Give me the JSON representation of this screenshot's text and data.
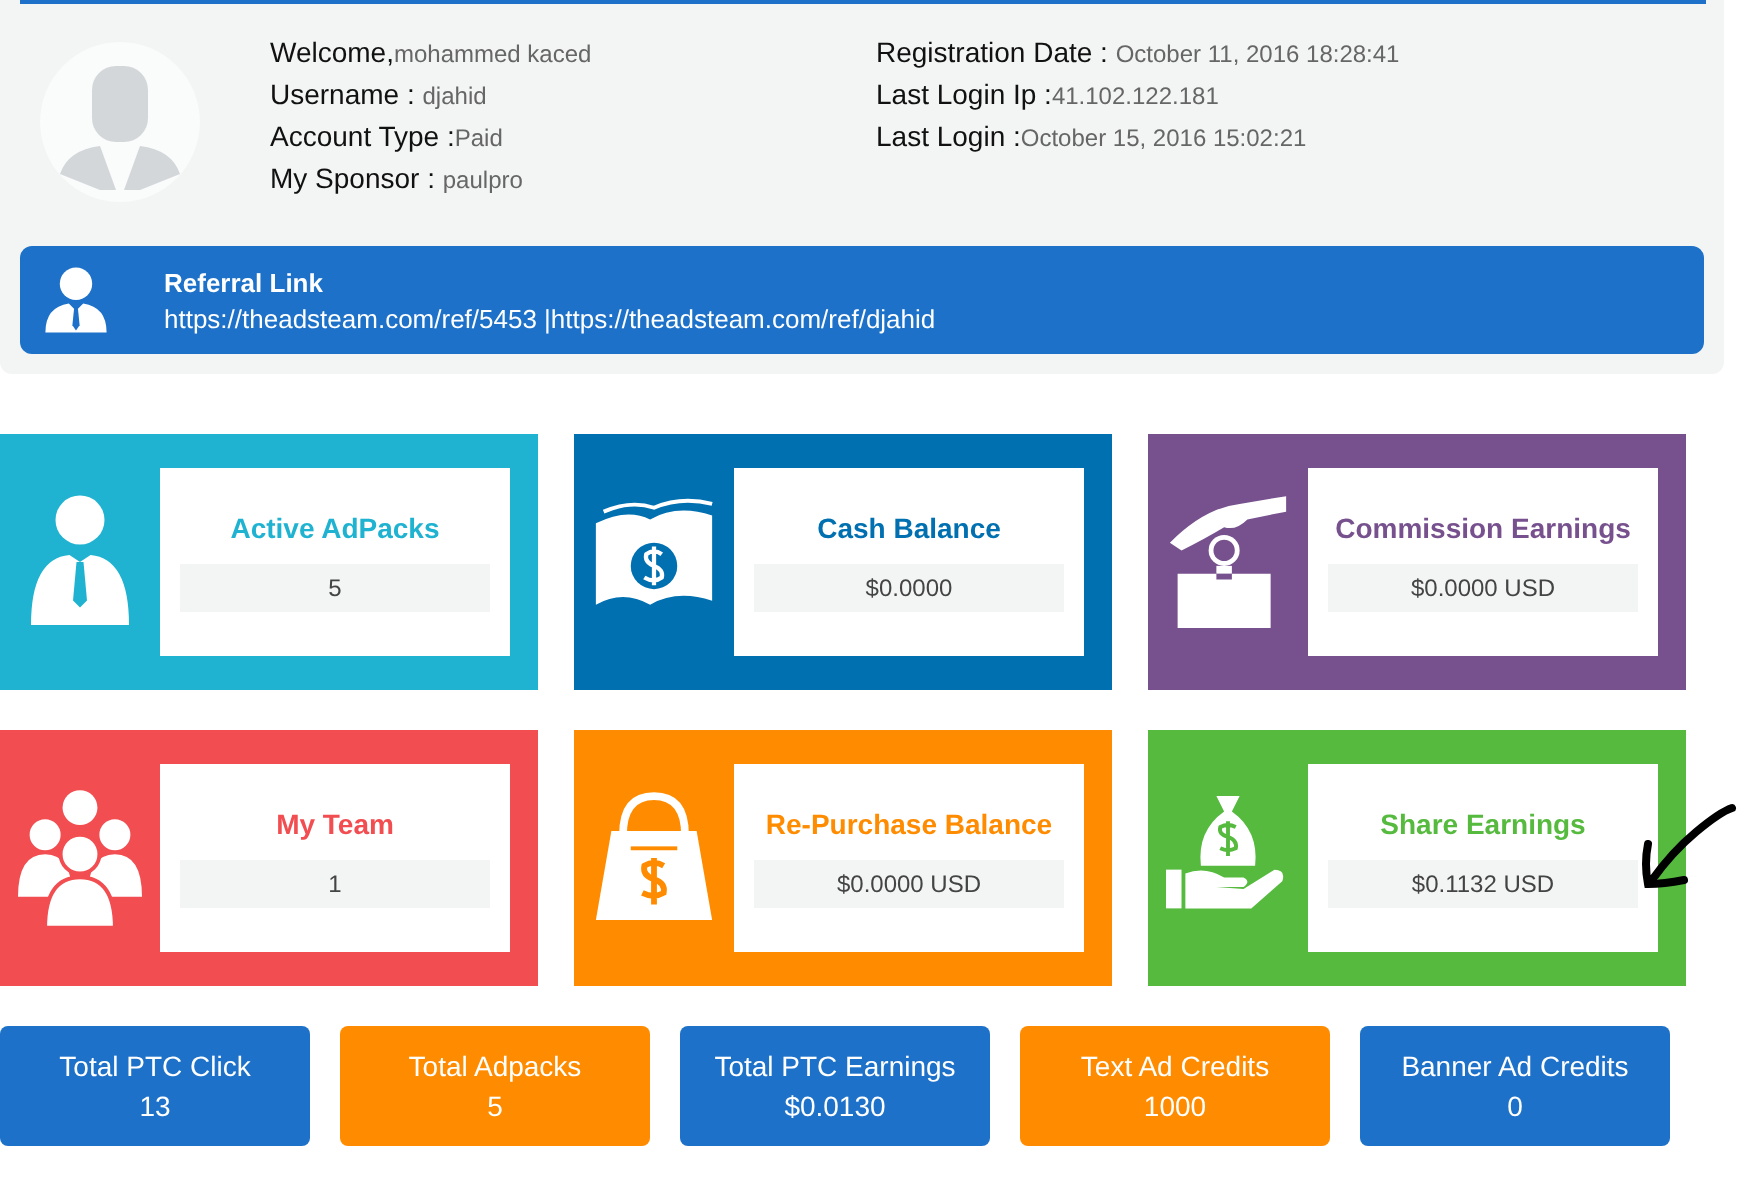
{
  "profile": {
    "info_left": [
      {
        "label": "Welcome,",
        "value": "mohammed kaced"
      },
      {
        "label": "Username : ",
        "value": "djahid"
      },
      {
        "label": "Account Type :",
        "value": "Paid"
      },
      {
        "label": "My Sponsor : ",
        "value": "paulpro"
      }
    ],
    "info_right": [
      {
        "label": "Registration Date : ",
        "value": "October 11, 2016 18:28:41"
      },
      {
        "label": "Last Login Ip :",
        "value": "41.102.122.181"
      },
      {
        "label": "Last Login :",
        "value": "October 15, 2016 15:02:21"
      }
    ],
    "referral": {
      "title": "Referral Link",
      "links": "https://theadsteam.com/ref/5453 |https://theadsteam.com/ref/djahid"
    }
  },
  "cards": [
    {
      "kind": "person",
      "title": "Active AdPacks",
      "value": "5",
      "color": "#1fb3d1"
    },
    {
      "kind": "money",
      "title": "Cash Balance",
      "value": "$0.0000",
      "color": "#0170b0"
    },
    {
      "kind": "donate",
      "title": "Commission Earnings",
      "value": "$0.0000 USD",
      "color": "#77518e"
    },
    {
      "kind": "team",
      "title": "My Team",
      "value": "1",
      "color": "#f24d50"
    },
    {
      "kind": "bag",
      "title": "Re-Purchase Balance",
      "value": "$0.0000 USD",
      "color": "#ff8c00"
    },
    {
      "kind": "moneybag",
      "title": "Share Earnings",
      "value": "$0.1132 USD",
      "color": "#56ba3f"
    }
  ],
  "stats": [
    {
      "label": "Total PTC Click",
      "value": "13",
      "color": "#1d71c8"
    },
    {
      "label": "Total Adpacks",
      "value": "5",
      "color": "#ff8c00"
    },
    {
      "label": "Total PTC Earnings",
      "value": "$0.0130",
      "color": "#1d71c8"
    },
    {
      "label": "Text Ad Credits",
      "value": "1000",
      "color": "#ff8c00"
    },
    {
      "label": "Banner Ad Credits",
      "value": "0",
      "color": "#1d71c8"
    }
  ]
}
